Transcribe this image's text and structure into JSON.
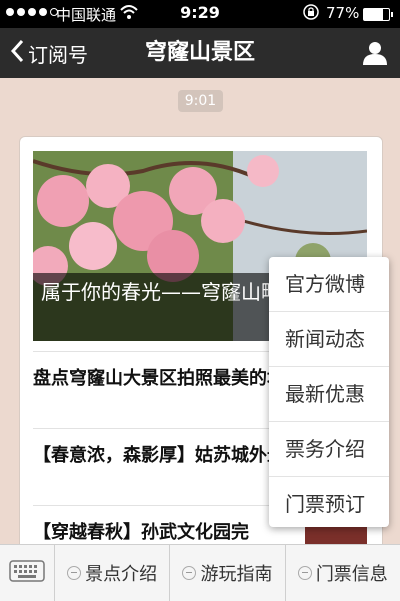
{
  "status": {
    "carrier": "中国联通",
    "time": "9:29",
    "battery": "77%",
    "battery_level": 0.77
  },
  "nav": {
    "back_label": "订阅号",
    "title": "穹窿山景区"
  },
  "timestamp": "9:01",
  "card": {
    "hero_caption": "属于你的春光——穹窿山略",
    "items": [
      {
        "title": "盘点穹窿山大景区拍照最美的地方"
      },
      {
        "title": "【春意浓，森影厚】姑苏城外最美森林"
      },
      {
        "title": "【穿越春秋】孙武文化园完"
      }
    ]
  },
  "menu": {
    "items": [
      "官方微博",
      "新闻动态",
      "最新优惠",
      "票务介绍",
      "门票预订"
    ]
  },
  "bottom_tabs": [
    "景点介绍",
    "游玩指南",
    "门票信息"
  ],
  "icons": {
    "back": "chevron-left-icon",
    "profile": "person-icon",
    "keyboard": "keyboard-icon"
  }
}
